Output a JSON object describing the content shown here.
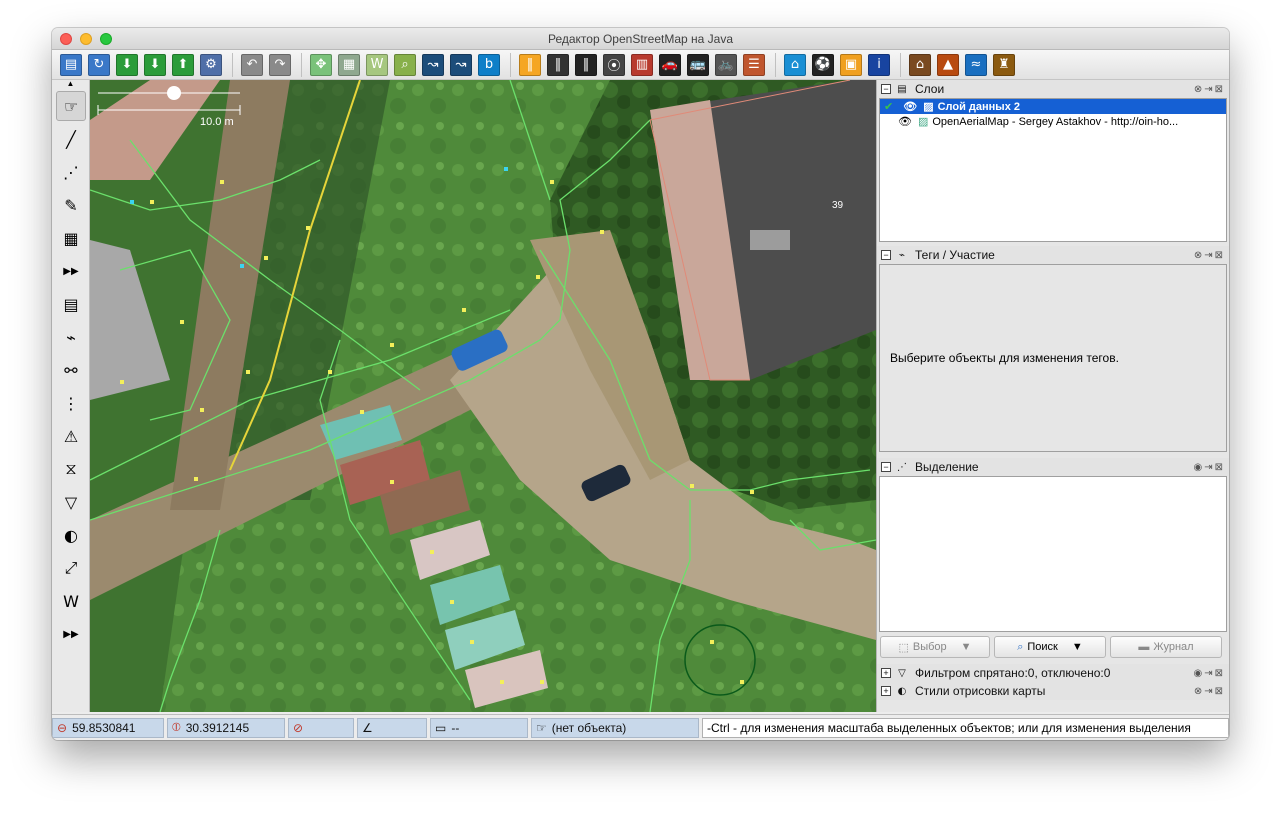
{
  "window": {
    "title": "Редактор OpenStreetMap на Java"
  },
  "toolbar": {
    "groups": [
      [
        {
          "name": "open-file-icon",
          "glyph": "▤",
          "color": "#3a78c8"
        },
        {
          "name": "open-location-icon",
          "glyph": "↻",
          "color": "#3a78c8"
        },
        {
          "name": "download-icon",
          "glyph": "⬇",
          "color": "#2b9c3a"
        },
        {
          "name": "download-area-icon",
          "glyph": "⬇",
          "color": "#2b9c3a"
        },
        {
          "name": "upload-icon",
          "glyph": "⬆",
          "color": "#2b9c3a"
        },
        {
          "name": "preferences-globe-icon",
          "glyph": "⚙",
          "color": "#4f6fa8"
        }
      ],
      [
        {
          "name": "undo-icon",
          "glyph": "↶",
          "color": "#8a8a8a"
        },
        {
          "name": "redo-icon",
          "glyph": "↷",
          "color": "#8a8a8a"
        }
      ],
      [
        {
          "name": "zoom-extents-icon",
          "glyph": "✥",
          "color": "#7ac27a"
        },
        {
          "name": "download-imagery-icon",
          "glyph": "▦",
          "color": "#8fa88f"
        },
        {
          "name": "wms-icon",
          "glyph": "W",
          "color": "#a6c77f"
        },
        {
          "name": "search-icon",
          "glyph": "⌕",
          "color": "#88b04b"
        },
        {
          "name": "road-link-icon",
          "glyph": "↝",
          "color": "#1c4d7a"
        },
        {
          "name": "road-link-alt-icon",
          "glyph": "↝",
          "color": "#1c4d7a"
        },
        {
          "name": "bing-icon",
          "glyph": "b",
          "color": "#0e7fc8"
        }
      ],
      [
        {
          "name": "highway-icon",
          "glyph": "‖",
          "color": "#f5a623"
        },
        {
          "name": "road-icon",
          "glyph": "‖",
          "color": "#333333"
        },
        {
          "name": "motorway-icon",
          "glyph": "‖",
          "color": "#222222"
        },
        {
          "name": "traffic-light-icon",
          "glyph": "⦿",
          "color": "#444444"
        },
        {
          "name": "wall-icon",
          "glyph": "▥",
          "color": "#b83a2e"
        },
        {
          "name": "car-icon",
          "glyph": "🚗",
          "color": "#222222"
        },
        {
          "name": "bus-icon",
          "glyph": "🚌",
          "color": "#222222"
        },
        {
          "name": "bicycle-icon",
          "glyph": "🚲",
          "color": "#555555"
        },
        {
          "name": "railway-icon",
          "glyph": "☰",
          "color": "#c0562e"
        }
      ],
      [
        {
          "name": "hotel-icon",
          "glyph": "⌂",
          "color": "#1a8fd4"
        },
        {
          "name": "football-icon",
          "glyph": "⚽",
          "color": "#222222"
        },
        {
          "name": "shop-icon",
          "glyph": "▣",
          "color": "#f0a020"
        },
        {
          "name": "info-icon",
          "glyph": "i",
          "color": "#1844a0"
        }
      ],
      [
        {
          "name": "industrial-icon",
          "glyph": "⌂",
          "color": "#7a4a20"
        },
        {
          "name": "peak-icon",
          "glyph": "▲",
          "color": "#b84a10"
        },
        {
          "name": "waterway-icon",
          "glyph": "≈",
          "color": "#1a6fc0"
        },
        {
          "name": "castle-icon",
          "glyph": "♜",
          "color": "#8b5a10"
        }
      ]
    ]
  },
  "left_tools": [
    {
      "name": "select-tool-icon",
      "glyph": "☞",
      "active": true
    },
    {
      "name": "draw-line-icon",
      "glyph": "╱",
      "active": false
    },
    {
      "name": "draw-node-icon",
      "glyph": "⋰",
      "active": false
    },
    {
      "name": "pencil-icon",
      "glyph": "✎",
      "active": false
    },
    {
      "name": "building-tool-icon",
      "glyph": "▦",
      "active": false
    },
    {
      "name": "more-tools-icon",
      "glyph": "▶▶",
      "active": false
    },
    {
      "name": "layers-toggle-icon",
      "glyph": "▤",
      "active": false
    },
    {
      "name": "tags-toggle-icon",
      "glyph": "⌁",
      "active": false
    },
    {
      "name": "relations-toggle-icon",
      "glyph": "⚯",
      "active": false
    },
    {
      "name": "nodes-toggle-icon",
      "glyph": "⋮",
      "active": false
    },
    {
      "name": "conflict-toggle-icon",
      "glyph": "⚠",
      "active": false
    },
    {
      "name": "validation-toggle-icon",
      "glyph": "⧖",
      "active": false
    },
    {
      "name": "filter-toggle-icon",
      "glyph": "▽",
      "active": false
    },
    {
      "name": "map-paint-toggle-icon",
      "glyph": "◐",
      "active": false
    },
    {
      "name": "imagery-offset-toggle-icon",
      "glyph": "⤢",
      "active": false
    },
    {
      "name": "wiki-toggle-icon",
      "glyph": "W",
      "active": false
    },
    {
      "name": "more-panels-icon",
      "glyph": "▶▶",
      "active": false
    }
  ],
  "map": {
    "scale_label": "10.0 m",
    "building_number": "39"
  },
  "panels": {
    "layers": {
      "title": "Слои",
      "items": [
        {
          "label": "Слой данных 2",
          "selected": true
        },
        {
          "label": "OpenAerialMap - Sergey Astakhov - http://oin-ho...",
          "selected": false
        }
      ]
    },
    "tags": {
      "title": "Теги / Участие",
      "empty_message": "Выберите объекты для изменения тегов."
    },
    "selection": {
      "title": "Выделение",
      "buttons": {
        "select": "Выбор",
        "search": "Поиск",
        "history": "Журнал"
      }
    },
    "filter": {
      "title": "Фильтром спрятано:0, отключено:0"
    },
    "map_paint": {
      "title": "Стили отрисовки карты"
    }
  },
  "statusbar": {
    "latitude": "59.8530841",
    "longitude": "30.3912145",
    "heading": "",
    "angle": "",
    "distance": "--",
    "object": "(нет объекта)",
    "help": "-Ctrl - для изменения масштаба выделенных объектов; или для изменения выделения"
  }
}
